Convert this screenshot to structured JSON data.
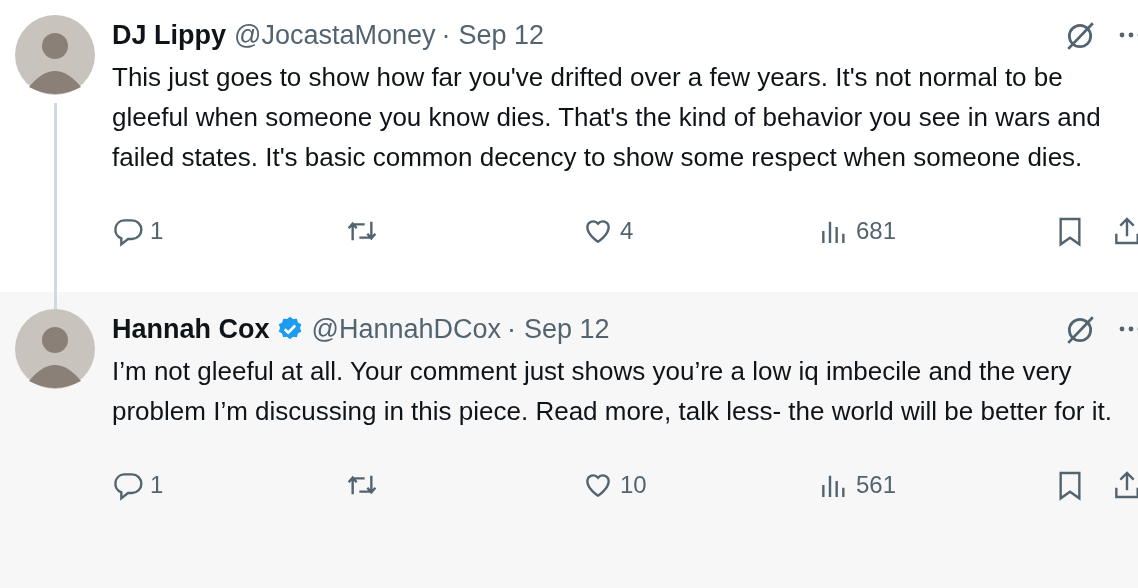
{
  "tweets": [
    {
      "name": "DJ Lippy",
      "verified": false,
      "handle": "@JocastaMoney",
      "separator": "·",
      "date": "Sep 12",
      "text": "This just goes to show how far you've drifted over a few years. It's not normal to be gleeful when someone you know dies. That's the kind of behavior you see in wars and failed states. It's basic common decency to show some respect when someone dies.",
      "highlighted": false,
      "thread_line": true,
      "replies": "1",
      "likes": "4",
      "views": "681"
    },
    {
      "name": "Hannah Cox",
      "verified": true,
      "handle": "@HannahDCox",
      "separator": "·",
      "date": "Sep 12",
      "text": "I’m not gleeful at all. Your comment just shows you’re a low iq imbecile and the very problem I’m discussing in this piece. Read more, talk less- the world will be better for it.",
      "highlighted": true,
      "thread_line": false,
      "replies": "1",
      "likes": "10",
      "views": "561"
    }
  ]
}
